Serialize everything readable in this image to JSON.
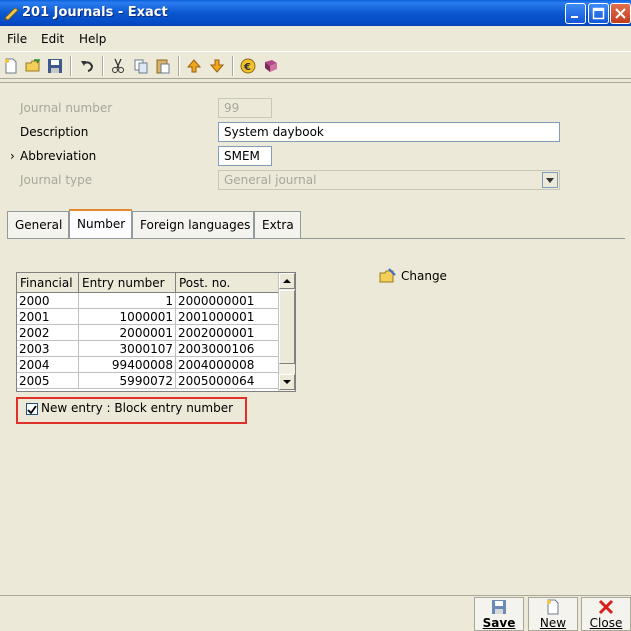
{
  "window": {
    "title": "201 Journals - Exact"
  },
  "menu": {
    "file": "File",
    "edit": "Edit",
    "help": "Help"
  },
  "toolbar": [
    "new-doc-icon",
    "open-folder-icon",
    "save-icon",
    "undo-icon",
    "cut-icon",
    "copy-icon",
    "paste-icon",
    "arrow-up-icon",
    "arrow-down-icon",
    "euro-icon",
    "book-icon"
  ],
  "form": {
    "journal_number_label": "Journal number",
    "journal_number_value": "99",
    "description_label": "Description",
    "description_value": "System daybook",
    "abbreviation_marker": "›",
    "abbreviation_label": "Abbreviation",
    "abbreviation_value": "SMEM",
    "journal_type_label": "Journal type",
    "journal_type_value": "General journal"
  },
  "tabs": [
    "General",
    "Number",
    "Foreign languages",
    "Extra"
  ],
  "active_tab": "Number",
  "grid": {
    "headers": [
      "Financial",
      "Entry number",
      "Post. no."
    ],
    "rows": [
      [
        "2000",
        "1",
        "2000000001"
      ],
      [
        "2001",
        "1000001",
        "2001000001"
      ],
      [
        "2002",
        "2000001",
        "2002000001"
      ],
      [
        "2003",
        "3000107",
        "2003000106"
      ],
      [
        "2004",
        "99400008",
        "2004000008"
      ],
      [
        "2005",
        "5990072",
        "2005000064"
      ]
    ]
  },
  "change_label": "Change",
  "checkbox": {
    "label": "New entry : Block entry number",
    "checked": true
  },
  "buttons": {
    "save": "Save",
    "new": "New",
    "close": "Close"
  },
  "colors": {
    "titlebar": "#0a58d0",
    "highlight": "#e0302a",
    "tab_accent": "#e68b2c"
  }
}
